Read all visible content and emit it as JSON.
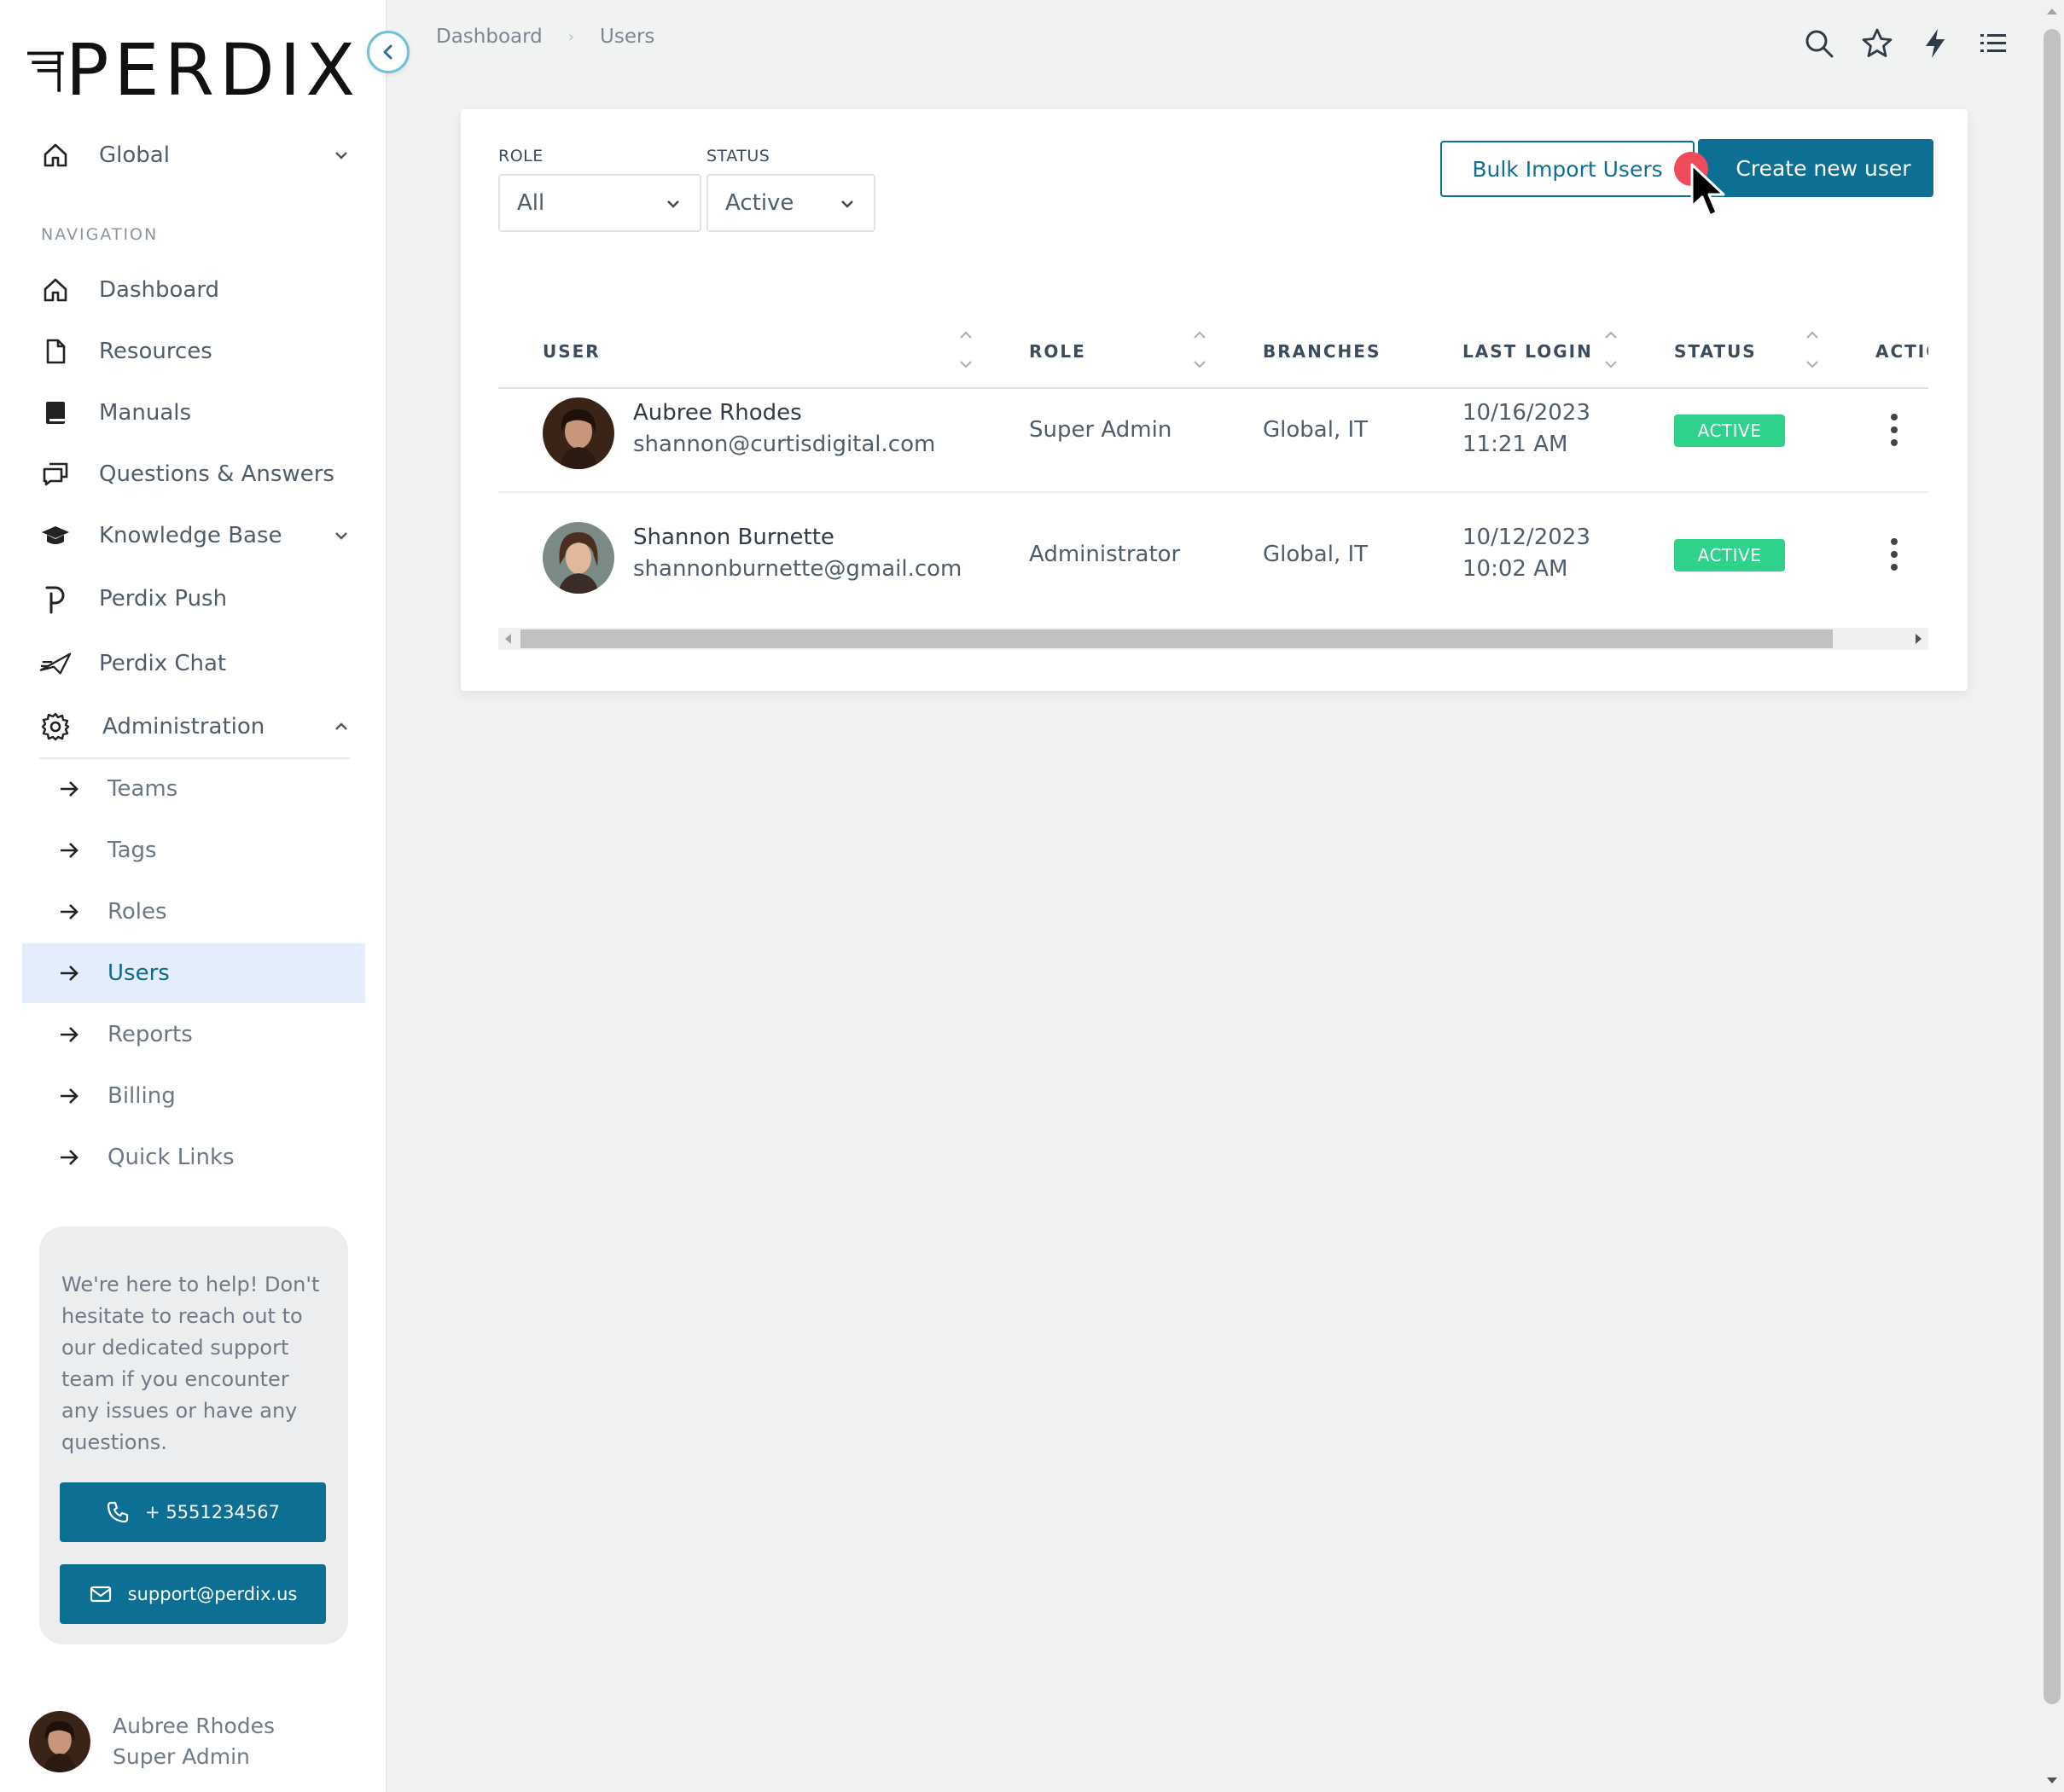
{
  "brand": {
    "name": "PERDIX"
  },
  "workspace": {
    "label": "Global"
  },
  "navigation": {
    "section_label": "NAVIGATION",
    "items": [
      {
        "label": "Dashboard",
        "icon": "home-icon"
      },
      {
        "label": "Resources",
        "icon": "file-icon"
      },
      {
        "label": "Manuals",
        "icon": "book-icon"
      },
      {
        "label": "Questions & Answers",
        "icon": "chat-bubbles-icon"
      },
      {
        "label": "Knowledge Base",
        "icon": "graduation-cap-icon"
      },
      {
        "label": "Perdix Push",
        "icon": "perdix-push-icon"
      },
      {
        "label": "Perdix Chat",
        "icon": "perdix-chat-icon"
      },
      {
        "label": "Administration",
        "icon": "gear-icon"
      }
    ],
    "admin_items": [
      {
        "label": "Teams"
      },
      {
        "label": "Tags"
      },
      {
        "label": "Roles"
      },
      {
        "label": "Users",
        "active": true
      },
      {
        "label": "Reports"
      },
      {
        "label": "Billing"
      },
      {
        "label": "Quick Links"
      }
    ]
  },
  "help": {
    "text": "We're here to help! Don't hesitate to reach out to our dedicated support team if you encounter any issues or have any questions.",
    "phone": "+ 5551234567",
    "email": "support@perdix.us"
  },
  "current_user": {
    "name": "Aubree Rhodes",
    "role": "Super Admin"
  },
  "breadcrumb": {
    "root": "Dashboard",
    "current": "Users"
  },
  "top_icons": [
    "search-icon",
    "star-icon",
    "lightning-icon",
    "list-icon"
  ],
  "filters": {
    "role": {
      "label": "ROLE",
      "value": "All"
    },
    "status": {
      "label": "STATUS",
      "value": "Active"
    }
  },
  "actions": {
    "bulk_import": "Bulk Import Users",
    "create": "Create new user"
  },
  "table": {
    "headers": {
      "user": "USER",
      "role": "ROLE",
      "branches": "BRANCHES",
      "last_login": "LAST LOGIN",
      "status": "STATUS",
      "actions": "ACTIC"
    },
    "rows": [
      {
        "name": "Aubree Rhodes",
        "email": "shannon@curtisdigital.com",
        "role": "Super Admin",
        "branches": "Global, IT",
        "login_date": "10/16/2023",
        "login_time": "11:21 AM",
        "status": "ACTIVE"
      },
      {
        "name": "Shannon Burnette",
        "email": "shannonburnette@gmail.com",
        "role": "Administrator",
        "branches": "Global, IT",
        "login_date": "10/12/2023",
        "login_time": "10:02 AM",
        "status": "ACTIVE"
      }
    ]
  },
  "colors": {
    "primary": "#0d6f93",
    "active_badge": "#2fd28a",
    "active_nav_bg": "#e3edfc",
    "click_dot": "#f14a5a"
  }
}
